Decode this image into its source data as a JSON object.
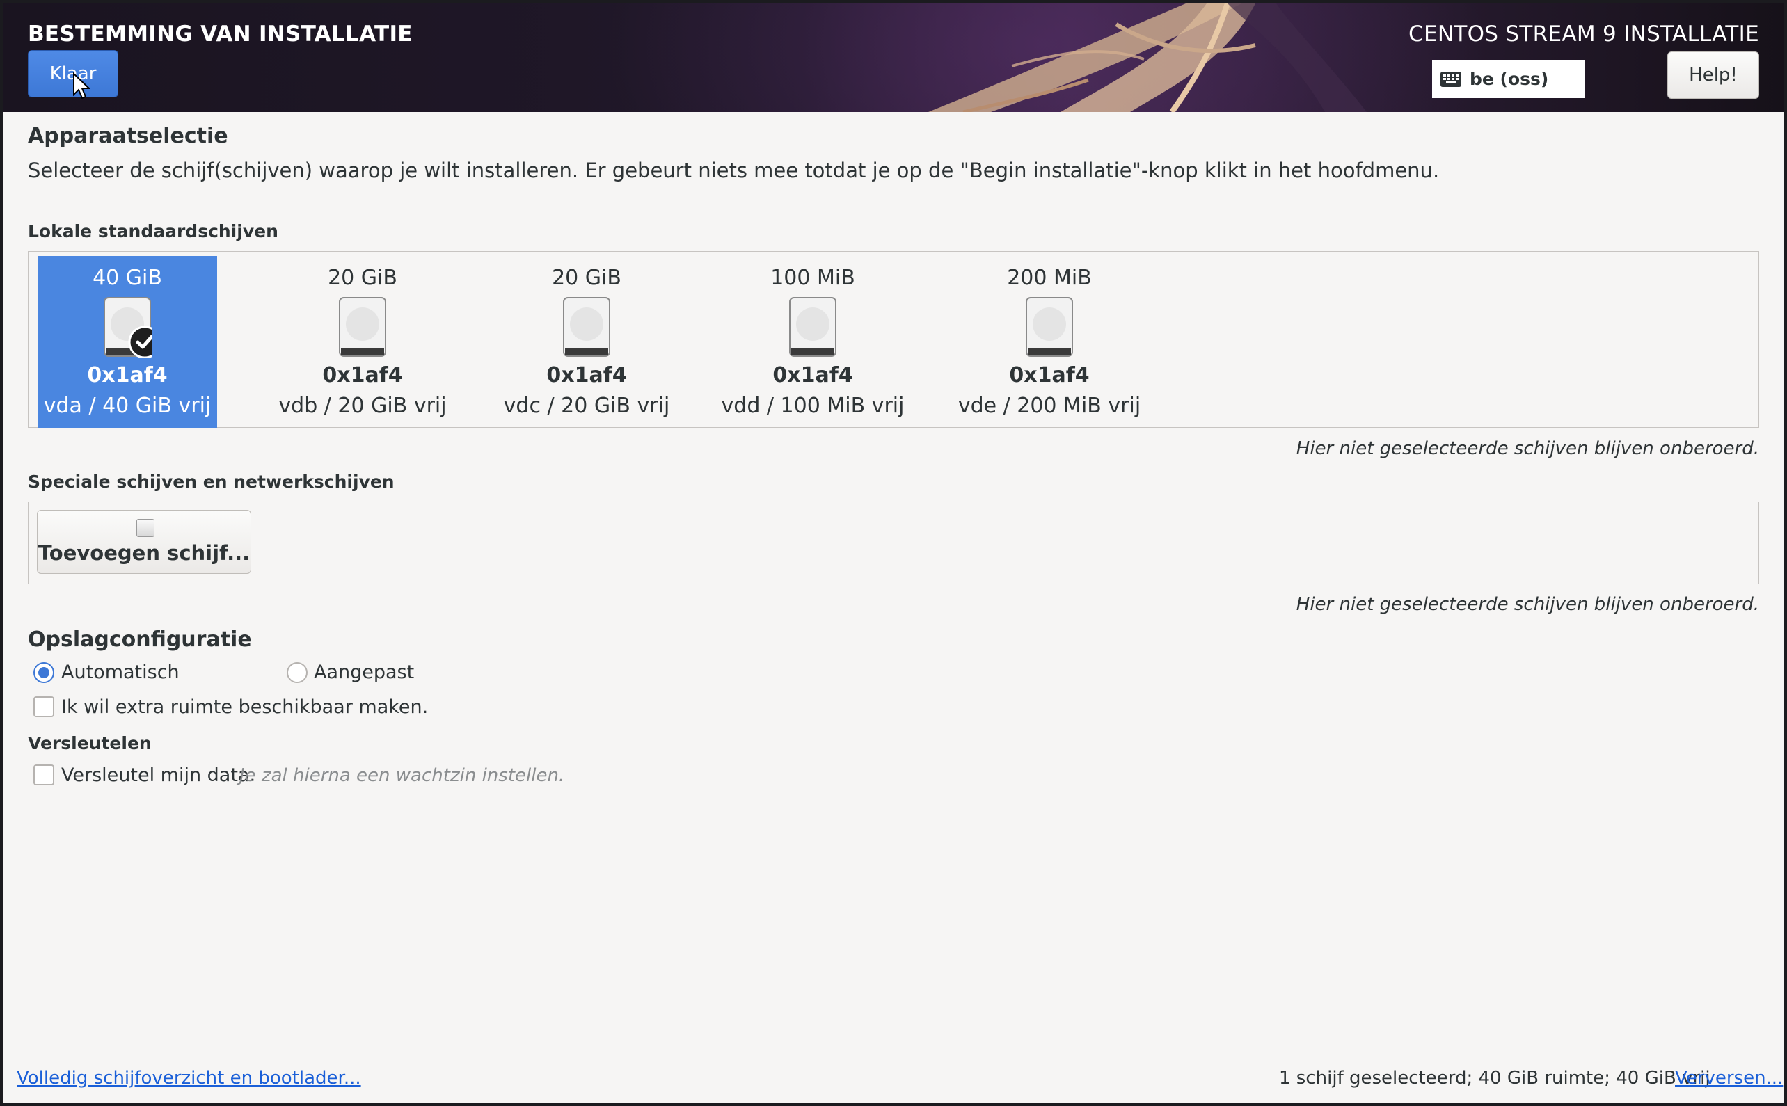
{
  "header": {
    "title": "BESTEMMING VAN INSTALLATIE",
    "product": "CENTOS STREAM 9 INSTALLATIE",
    "done_label": "Klaar",
    "keyboard_layout": "be (oss)",
    "help_label": "Help!"
  },
  "device_selection": {
    "heading": "Apparaatselectie",
    "description": "Selecteer de schijf(schijven) waarop je wilt installeren.  Er gebeurt niets mee totdat je op de \"Begin installatie\"-knop klikt in het hoofdmenu."
  },
  "local_disks": {
    "heading": "Lokale standaardschijven",
    "disks": [
      {
        "size": "40 GiB",
        "model": "0x1af4",
        "free": "vda  /  40 GiB vrij",
        "selected": true
      },
      {
        "size": "20 GiB",
        "model": "0x1af4",
        "free": "vdb  /  20 GiB vrij",
        "selected": false
      },
      {
        "size": "20 GiB",
        "model": "0x1af4",
        "free": "vdc  /  20 GiB vrij",
        "selected": false
      },
      {
        "size": "100 MiB",
        "model": "0x1af4",
        "free": "vdd  /  100 MiB vrij",
        "selected": false
      },
      {
        "size": "200 MiB",
        "model": "0x1af4",
        "free": "vde  /  200 MiB vrij",
        "selected": false
      }
    ],
    "note": "Hier niet geselecteerde schijven blijven onberoerd."
  },
  "special_disks": {
    "heading": "Speciale schijven en netwerkschijven",
    "add_label": "Toevoegen schijf...",
    "note": "Hier niet geselecteerde schijven blijven onberoerd."
  },
  "storage_config": {
    "heading": "Opslagconfiguratie",
    "automatic_label": "Automatisch",
    "custom_label": "Aangepast",
    "selected": "Automatisch",
    "reclaim_label": "Ik wil extra ruimte beschikbaar maken.",
    "reclaim_checked": false
  },
  "encryption": {
    "heading": "Versleutelen",
    "encrypt_label": "Versleutel mijn data.",
    "encrypt_hint": "Je zal hierna een wachtzin instellen.",
    "encrypt_checked": false
  },
  "footer": {
    "summary_link": "Volledig schijfoverzicht en bootlader...",
    "status": "1 schijf geselecteerd; 40 GiB ruimte; 40 GiB vrij",
    "refresh_link": "Verversen..."
  },
  "colors": {
    "accent": "#4a86e0",
    "link": "#1a5fd8",
    "background": "#f6f5f4"
  }
}
